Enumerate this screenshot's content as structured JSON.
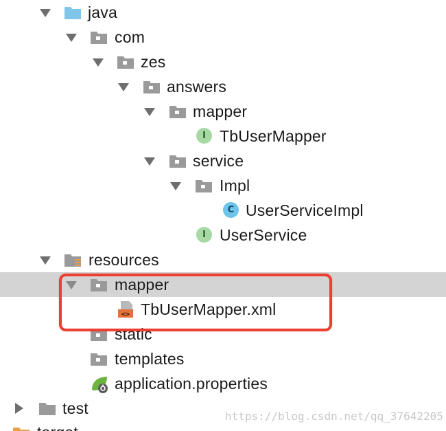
{
  "tree": [
    {
      "label": "java",
      "arrow": "down",
      "icon": "folder-source-icon"
    },
    {
      "label": "com",
      "arrow": "down",
      "icon": "package-icon"
    },
    {
      "label": "zes",
      "arrow": "down",
      "icon": "package-icon"
    },
    {
      "label": "answers",
      "arrow": "down",
      "icon": "package-icon"
    },
    {
      "label": "mapper",
      "arrow": "down",
      "icon": "package-icon"
    },
    {
      "label": "TbUserMapper",
      "badge": "I",
      "icon": "interface-icon"
    },
    {
      "label": "service",
      "arrow": "down",
      "icon": "package-icon"
    },
    {
      "label": "Impl",
      "arrow": "down",
      "icon": "package-icon"
    },
    {
      "label": "UserServiceImpl",
      "badge": "C",
      "icon": "class-icon"
    },
    {
      "label": "UserService",
      "badge": "I",
      "icon": "interface-icon"
    },
    {
      "label": "resources",
      "arrow": "down",
      "icon": "folder-resources-icon"
    },
    {
      "label": "mapper",
      "arrow": "down",
      "icon": "package-icon",
      "selected": true
    },
    {
      "label": "TbUserMapper.xml",
      "icon": "xml-file-icon"
    },
    {
      "label": "static",
      "icon": "package-icon"
    },
    {
      "label": "templates",
      "icon": "package-icon"
    },
    {
      "label": "application.properties",
      "icon": "spring-properties-icon"
    },
    {
      "label": "test",
      "arrow": "right",
      "icon": "folder-icon"
    },
    {
      "label": "target",
      "icon": "folder-excluded-icon"
    }
  ],
  "colors": {
    "selection": "#d4d4d4",
    "highlight_border": "#ea3f31",
    "folder_source": "#7fc6ea",
    "package": "#9a9a9a",
    "interface_badge": "#a6d9a3",
    "class_badge": "#6fc4ec",
    "xml": "#e2733b",
    "spring": "#6db33f",
    "excluded": "#e8a04a"
  },
  "watermark": "https://blog.csdn.net/qq_37642205"
}
